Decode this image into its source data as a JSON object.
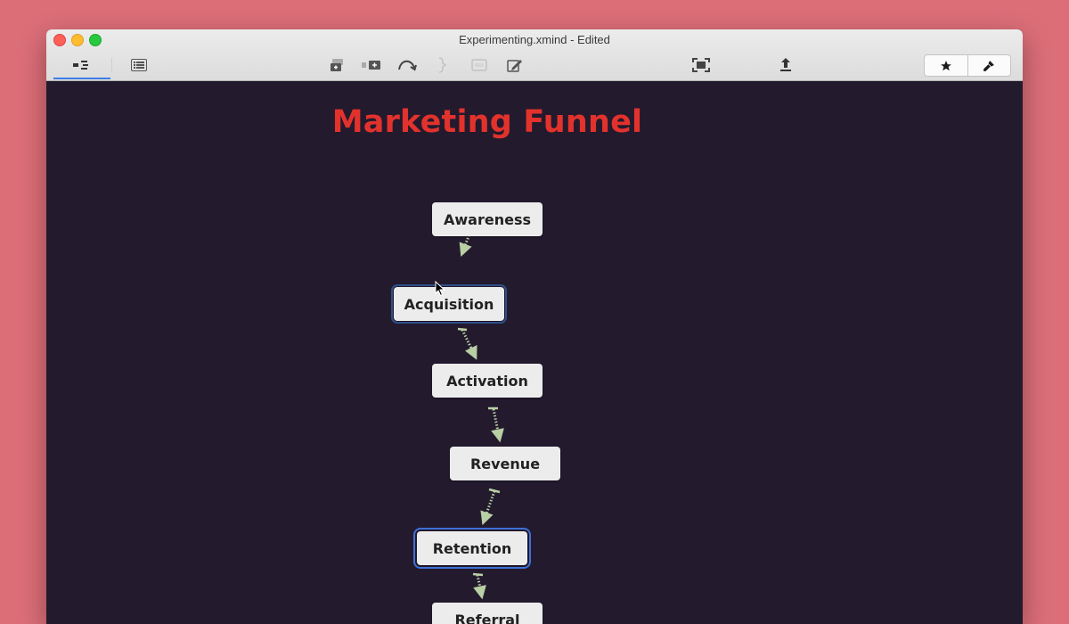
{
  "window": {
    "title": "Experimenting.xmind - Edited"
  },
  "toolbar": {
    "tabs": [
      {
        "name": "mind-map-view-tab",
        "icon": "mindmap-view-icon",
        "active": true
      },
      {
        "name": "outliner-view-tab",
        "icon": "outline-list-icon",
        "active": false
      }
    ],
    "tools": [
      {
        "icon": "add-topic-icon",
        "enabled": true
      },
      {
        "icon": "add-subtopic-icon",
        "enabled": true
      },
      {
        "icon": "relationship-icon",
        "enabled": true
      },
      {
        "icon": "summary-icon",
        "enabled": false
      },
      {
        "icon": "boundary-icon",
        "enabled": false
      },
      {
        "icon": "note-icon",
        "enabled": true
      },
      {
        "icon": "zen-mode-icon",
        "enabled": true
      },
      {
        "icon": "share-icon",
        "enabled": true
      },
      {
        "icon": "star-icon",
        "enabled": true
      },
      {
        "icon": "format-brush-icon",
        "enabled": true
      }
    ]
  },
  "map": {
    "title": "Marketing Funnel",
    "title_color": "#e2322c",
    "background": "#231a2e",
    "connector_color": "#b9cfa4",
    "nodes": [
      {
        "label": "Awareness",
        "state": "normal"
      },
      {
        "label": "Acquisition",
        "state": "hover"
      },
      {
        "label": "Activation",
        "state": "normal"
      },
      {
        "label": "Revenue",
        "state": "normal"
      },
      {
        "label": "Retention",
        "state": "selected"
      },
      {
        "label": "Referral",
        "state": "normal"
      }
    ]
  }
}
